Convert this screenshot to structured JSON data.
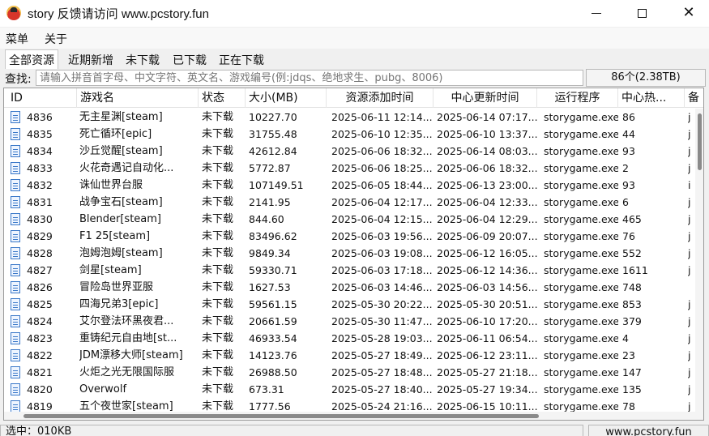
{
  "window": {
    "title": "story 反馈请访问 www.pcstory.fun",
    "minimize_icon": "minimize-icon",
    "maximize_icon": "maximize-icon",
    "close_icon": "close-icon",
    "close_glyph": "✕"
  },
  "menubar": {
    "items": [
      "菜单",
      "关于"
    ]
  },
  "tabs": [
    {
      "label": "全部资源",
      "active": true
    },
    {
      "label": "近期新增",
      "active": false
    },
    {
      "label": "未下载",
      "active": false
    },
    {
      "label": "已下载",
      "active": false
    },
    {
      "label": "正在下载",
      "active": false
    }
  ],
  "search": {
    "label": "查找:",
    "value": "",
    "placeholder": "请输入拼音首字母、中文字符、英文名、游戏编号(例:jdqs、绝地求生、pubg、8006)"
  },
  "summary": {
    "count": "86个(2.38TB)"
  },
  "table": {
    "columns": [
      "ID",
      "游戏名",
      "状态",
      "大小(MB)",
      "资源添加时间",
      "中心更新时间",
      "运行程序",
      "中心热...",
      "备"
    ],
    "rows": [
      [
        "4836",
        "无主星渊[steam]",
        "未下载",
        "10227.70",
        "2025-06-11 12:14...",
        "2025-06-14 07:17...",
        "storygame.exe",
        "86",
        "j"
      ],
      [
        "4835",
        "死亡循环[epic]",
        "未下载",
        "31755.48",
        "2025-06-10 12:35...",
        "2025-06-10 13:37...",
        "storygame.exe",
        "44",
        "j"
      ],
      [
        "4834",
        "沙丘觉醒[steam]",
        "未下载",
        "42612.84",
        "2025-06-06 18:32...",
        "2025-06-14 08:03...",
        "storygame.exe",
        "93",
        "j"
      ],
      [
        "4833",
        "火花奇遇记自动化...",
        "未下载",
        "5772.87",
        "2025-06-06 18:25...",
        "2025-06-06 18:32...",
        "storygame.exe",
        "2",
        "j"
      ],
      [
        "4832",
        "诛仙世界台服",
        "未下载",
        "107149.51",
        "2025-06-05 18:44...",
        "2025-06-13 23:00...",
        "storygame.exe",
        "93",
        "i"
      ],
      [
        "4831",
        "战争宝石[steam]",
        "未下载",
        "2141.95",
        "2025-06-04 12:17...",
        "2025-06-04 12:33...",
        "storygame.exe",
        "6",
        "j"
      ],
      [
        "4830",
        "Blender[steam]",
        "未下载",
        "844.60",
        "2025-06-04 12:15...",
        "2025-06-04 12:29...",
        "storygame.exe",
        "465",
        "j"
      ],
      [
        "4829",
        "F1 25[steam]",
        "未下载",
        "83496.62",
        "2025-06-03 19:56...",
        "2025-06-09 20:07...",
        "storygame.exe",
        "76",
        "j"
      ],
      [
        "4828",
        "泡姆泡姆[steam]",
        "未下载",
        "9849.34",
        "2025-06-03 19:08...",
        "2025-06-12 16:05...",
        "storygame.exe",
        "552",
        "j"
      ],
      [
        "4827",
        "剑星[steam]",
        "未下载",
        "59330.71",
        "2025-06-03 17:18...",
        "2025-06-12 14:36...",
        "storygame.exe",
        "1611",
        "j"
      ],
      [
        "4826",
        "冒险岛世界亚服",
        "未下载",
        "1627.53",
        "2025-06-03 14:46...",
        "2025-06-03 14:56...",
        "storygame.exe",
        "748",
        ""
      ],
      [
        "4825",
        "四海兄弟3[epic]",
        "未下载",
        "59561.15",
        "2025-05-30 20:22...",
        "2025-05-30 20:51...",
        "storygame.exe",
        "853",
        "j"
      ],
      [
        "4824",
        "艾尔登法环黑夜君...",
        "未下载",
        "20661.59",
        "2025-05-30 11:47...",
        "2025-06-10 17:20...",
        "storygame.exe",
        "379",
        "j"
      ],
      [
        "4823",
        "重铸纪元自由地[st...",
        "未下载",
        "46933.54",
        "2025-05-28 19:03...",
        "2025-06-11 06:54...",
        "storygame.exe",
        "4",
        "j"
      ],
      [
        "4822",
        "JDM漂移大师[steam]",
        "未下载",
        "14123.76",
        "2025-05-27 18:49...",
        "2025-06-12 23:11...",
        "storygame.exe",
        "23",
        "j"
      ],
      [
        "4821",
        "火炬之光无限国际服",
        "未下载",
        "26988.50",
        "2025-05-27 18:48...",
        "2025-05-27 21:18...",
        "storygame.exe",
        "147",
        "j"
      ],
      [
        "4820",
        "Overwolf",
        "未下载",
        "673.31",
        "2025-05-27 18:40...",
        "2025-05-27 19:34...",
        "storygame.exe",
        "135",
        "j"
      ],
      [
        "4819",
        "五个夜世家[steam]",
        "未下载",
        "1777.56",
        "2025-05-24 21:16...",
        "2025-06-15 10:11...",
        "storygame.exe",
        "78",
        "j"
      ]
    ]
  },
  "statusbar": {
    "left": "选中：010KB",
    "right": "www.pcstory.fun"
  },
  "colors": {
    "accent": "#3a78c8",
    "background": "#f0f0f0"
  }
}
